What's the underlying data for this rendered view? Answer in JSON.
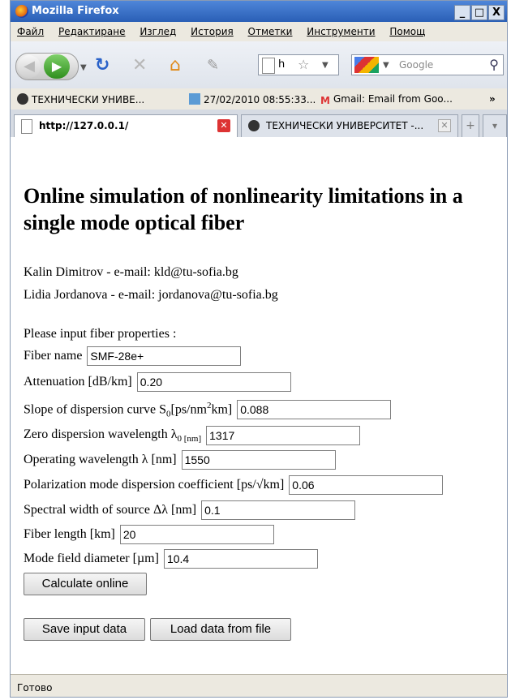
{
  "window": {
    "title": "Mozilla Firefox",
    "minimize": "_",
    "maximize": "□",
    "close": "X"
  },
  "menu": [
    "Файл",
    "Редактиране",
    "Изглед",
    "История",
    "Отметки",
    "Инструменти",
    "Помощ"
  ],
  "toolbar": {
    "url_partial": "h",
    "search_placeholder": "Google"
  },
  "bookmarks": [
    "ТЕХНИЧЕСКИ УНИВЕ...",
    "27/02/2010 08:55:33...",
    "Gmail: Email from Goo..."
  ],
  "bookmarks_overflow": "»",
  "tabs": [
    {
      "label": "http://127.0.0.1/",
      "active": true
    },
    {
      "label": "ТЕХНИЧЕСКИ УНИВЕРСИТЕТ -...",
      "active": false
    }
  ],
  "page": {
    "title": "Online simulation of nonlinearity limitations in a single mode optical fiber",
    "authors": [
      "Kalin Dimitrov - e-mail: kld@tu-sofia.bg",
      "Lidia Jordanova - e-mail: jordanova@tu-sofia.bg"
    ],
    "prompt": "Please input fiber properties :",
    "fields": {
      "fiber_name": {
        "label": "Fiber name",
        "value": "SMF-28e+"
      },
      "attenuation": {
        "label": "Attenuation [dB/km]",
        "value": "0.20"
      },
      "slope": {
        "label_a": "Slope of dispersion curve S",
        "label_sub": "0",
        "label_b": "[ps/nm",
        "label_sup": "2",
        "label_c": "km]",
        "value": "0.088"
      },
      "zero_disp": {
        "label_a": "Zero dispersion wavelength λ",
        "label_sub": "0 [nm]",
        "value": "1317"
      },
      "operating": {
        "label": "Operating wavelength λ [nm]",
        "value": "1550"
      },
      "pmd": {
        "label": "Polarization mode dispersion coefficient [ps/√km]",
        "value": "0.06"
      },
      "spectral": {
        "label": "Spectral width of source Δλ [nm]",
        "value": "0.1"
      },
      "length": {
        "label": "Fiber length [km]",
        "value": "20"
      },
      "mfd": {
        "label": "Mode field diameter [µm]",
        "value": "10.4"
      }
    },
    "buttons": {
      "calculate": "Calculate online",
      "save": "Save input data",
      "load": "Load data from file"
    }
  },
  "status": "Готово"
}
